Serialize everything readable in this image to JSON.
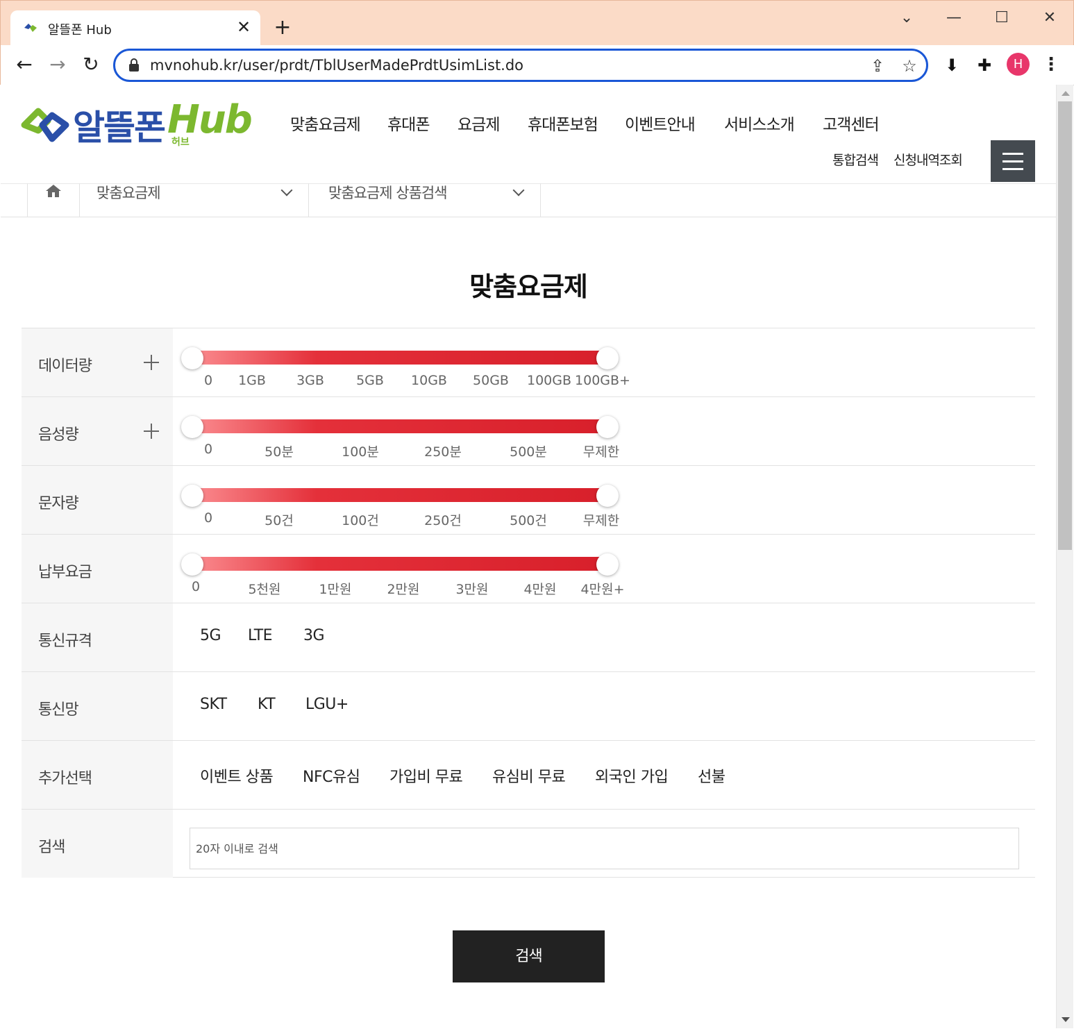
{
  "browser": {
    "tab_title": "알뜰폰 Hub",
    "url": "mvnohub.kr/user/prdt/TblUserMadePrdtUsimList.do",
    "avatar_letter": "H"
  },
  "header": {
    "logo_text": "알뜰폰",
    "logo_hub": "Hub",
    "logo_sub": "허브",
    "nav": [
      "맞춤요금제",
      "휴대폰",
      "요금제",
      "휴대폰보험",
      "이벤트안내",
      "서비스소개",
      "고객센터"
    ],
    "util": [
      "통합검색",
      "신청내역조회"
    ]
  },
  "breadcrumb": {
    "level1": "맞춤요금제",
    "level2": "맞춤요금제 상품검색"
  },
  "title": "맞춤요금제",
  "filters": {
    "data": {
      "label": "데이터량",
      "ticks": [
        "0",
        "1GB",
        "3GB",
        "5GB",
        "10GB",
        "50GB",
        "100GB",
        "100GB+"
      ],
      "selected_min": "0",
      "selected_max": "100GB+"
    },
    "voice": {
      "label": "음성량",
      "ticks": [
        "0",
        "50분",
        "100분",
        "250분",
        "500분",
        "무제한"
      ],
      "selected_min": "0",
      "selected_max": "무제한"
    },
    "sms": {
      "label": "문자량",
      "ticks": [
        "0",
        "50건",
        "100건",
        "250건",
        "500건",
        "무제한"
      ],
      "selected_min": "0",
      "selected_max": "무제한"
    },
    "fee": {
      "label": "납부요금",
      "ticks": [
        "0",
        "5천원",
        "1만원",
        "2만원",
        "3만원",
        "4만원",
        "4만원+"
      ],
      "selected_min": "0",
      "selected_max": "4만원+"
    },
    "tech": {
      "label": "통신규격",
      "options": [
        "5G",
        "LTE",
        "3G"
      ]
    },
    "network": {
      "label": "통신망",
      "options": [
        "SKT",
        "KT",
        "LGU+"
      ]
    },
    "extra": {
      "label": "추가선택",
      "options": [
        "이벤트 상품",
        "NFC유심",
        "가입비 무료",
        "유심비 무료",
        "외국인 가입",
        "선불"
      ]
    },
    "search": {
      "label": "검색",
      "placeholder": "20자 이내로 검색"
    }
  },
  "submit_label": "검색",
  "colors": {
    "slider_start": "#fa8a8e",
    "slider_end": "#d8202b",
    "submit_bg": "#222222",
    "logo_blue": "#2a4fa8",
    "logo_green": "#7cb82f",
    "url_focus": "#1a57d6"
  }
}
